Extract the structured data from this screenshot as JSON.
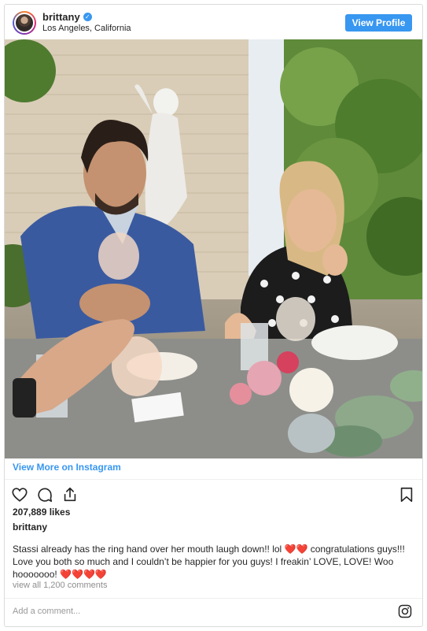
{
  "header": {
    "username": "brittany",
    "verified_mark": "✓",
    "location": "Los Angeles, California",
    "view_profile_label": "View Profile"
  },
  "post": {
    "image_alt": "Dinner party photo",
    "view_more_label": "View More on Instagram",
    "likes": "207,889 likes",
    "caption_user": "brittany",
    "caption_text": "Stassi already has the ring hand over her mouth laugh down!! lol ❤️❤️ congratulations guys!!! Love you both so much and I couldn’t be happier for you guys! I freakin’ LOVE, LOVE! Woo hooooooo! ❤️❤️❤️❤️",
    "view_comments": "view all 1,200 comments",
    "add_comment_placeholder": "Add a comment..."
  },
  "icons": {
    "like": "heart-icon",
    "comment": "comment-icon",
    "share": "share-icon",
    "save": "bookmark-icon",
    "brand": "instagram-icon"
  },
  "colors": {
    "accent": "#3897f0",
    "text": "#262626",
    "muted": "#8e8e8e",
    "border": "#dbdbdb"
  }
}
